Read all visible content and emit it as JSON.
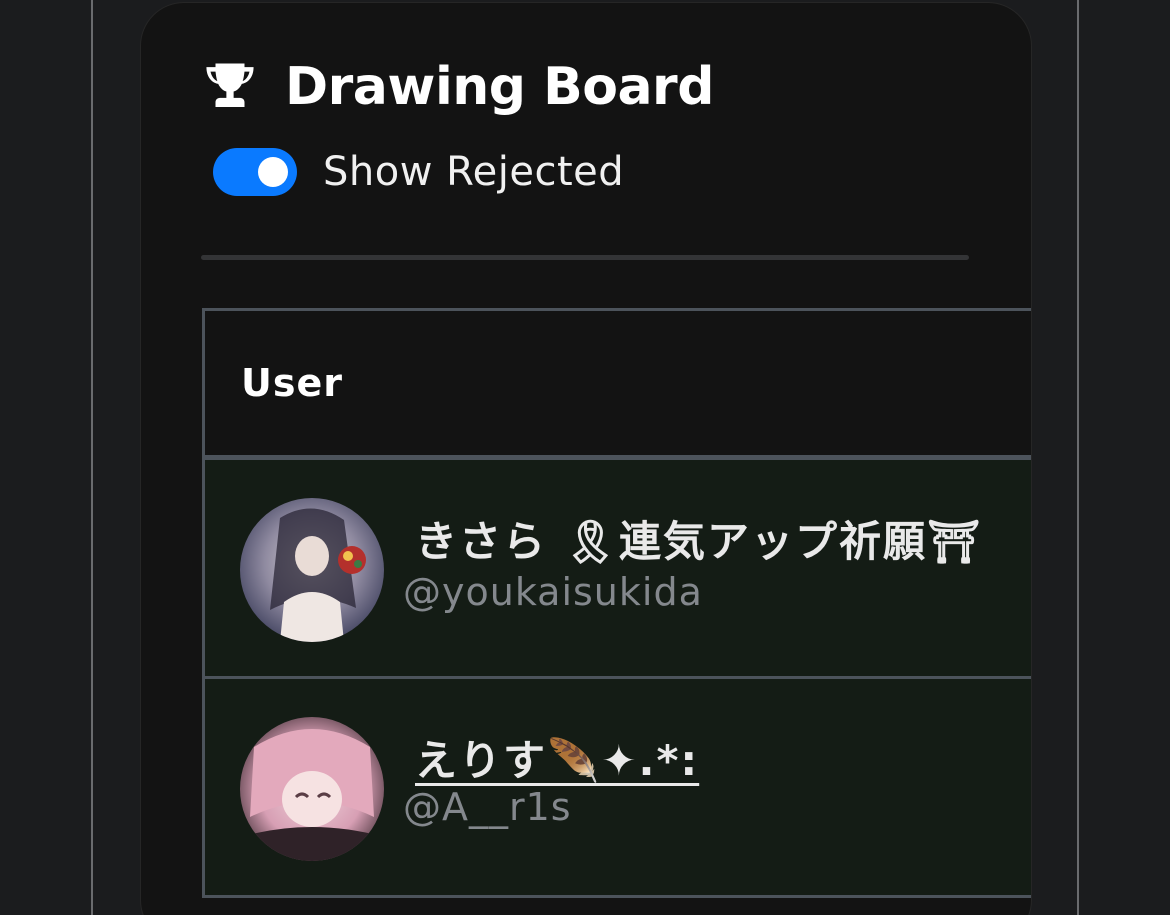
{
  "header": {
    "title": "Drawing Board",
    "icon": "trophy-icon"
  },
  "filters": {
    "show_rejected_label": "Show Rejected",
    "show_rejected_on": true,
    "accent_color": "#0a7aff"
  },
  "table": {
    "columns": [
      "User"
    ],
    "rows": [
      {
        "display_name": "きさら 🎗連気アップ祈願⛩",
        "handle": "@youkaisukida",
        "row_color": "#141c15"
      },
      {
        "display_name": "えりす🪶✦.*:",
        "handle": "@A__r1s",
        "row_color": "#141c15"
      }
    ]
  }
}
